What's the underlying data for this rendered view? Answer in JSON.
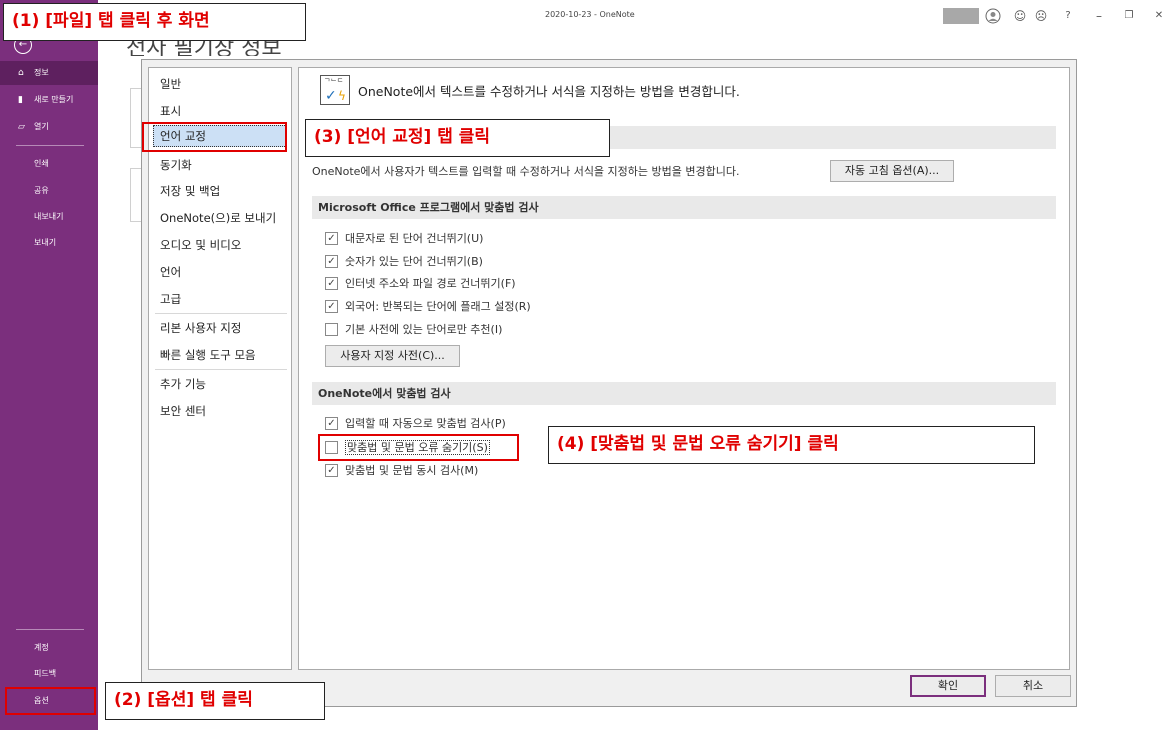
{
  "window": {
    "title": "2020-10-23  -  OneNote",
    "icons": [
      "avatar-icon",
      "smile-icon",
      "frown-icon",
      "help-icon",
      "minimize-icon",
      "restore-icon",
      "close-icon"
    ],
    "icon_glyphs": {
      "smile": "☺",
      "frown": "☹",
      "help": "?",
      "minimize": "–",
      "restore": "❐",
      "close": "✕"
    }
  },
  "leftnav": {
    "back_glyph": "←",
    "top_items": [
      {
        "label": "정보",
        "icon": "home-icon",
        "glyph": "⌂"
      },
      {
        "label": "새로 만들기",
        "icon": "new-page-icon",
        "glyph": "▮"
      },
      {
        "label": "열기",
        "icon": "folder-icon",
        "glyph": "▱"
      }
    ],
    "mid_items": [
      "인쇄",
      "공유",
      "내보내기",
      "보내기"
    ],
    "bottom_items": [
      "계정",
      "피드백",
      "옵션"
    ]
  },
  "backstage": {
    "title": "전자 필기장 정보"
  },
  "dialog": {
    "categories": [
      "일반",
      "표시",
      "언어 교정",
      "동기화",
      "저장 및 백업",
      "OneNote(으)로 보내기",
      "오디오 및 비디오",
      "언어",
      "고급",
      "리본 사용자 지정",
      "빠른 실행 도구 모음",
      "추가 기능",
      "보안 센터"
    ],
    "selected_category": "언어 교정",
    "header_text": "OneNote에서 텍스트를 수정하거나 서식을 지정하는 방법을 변경합니다.",
    "autocorrect": {
      "description": "OneNote에서 사용자가 텍스트를 입력할 때 수정하거나 서식을 지정하는 방법을 변경합니다.",
      "button": "자동 고침 옵션(A)..."
    },
    "office_section": {
      "title": "Microsoft Office 프로그램에서 맞춤법 검사",
      "options": [
        {
          "label": "대문자로 된 단어 건너뛰기(U)",
          "checked": true
        },
        {
          "label": "숫자가 있는 단어 건너뛰기(B)",
          "checked": true
        },
        {
          "label": "인터넷 주소와 파일 경로 건너뛰기(F)",
          "checked": true
        },
        {
          "label": "외국어: 반복되는 단어에 플래그 설정(R)",
          "checked": true
        },
        {
          "label": "기본 사전에 있는 단어로만 추천(I)",
          "checked": false
        }
      ],
      "dict_button": "사용자 지정 사전(C)..."
    },
    "onenote_section": {
      "title": "OneNote에서 맞춤법 검사",
      "options": [
        {
          "label": "입력할 때 자동으로 맞춤법 검사(P)",
          "checked": true
        },
        {
          "label": "맞춤법 및 문법 오류 숨기기(S)",
          "checked": false
        },
        {
          "label": "맞춤법 및 문법 동시 검사(M)",
          "checked": true
        }
      ]
    },
    "ok_button": "확인",
    "cancel_button": "취소"
  },
  "annotations": {
    "step1": "(1) [파일] 탭 클릭 후 화면",
    "step2": "(2) [옵션] 탭 클릭",
    "step3": "(3) [언어 교정] 탭 클릭",
    "step4": "(4) [맞춤법 및 문법 오류 숨기기] 클릭",
    "color": "#e00000"
  },
  "colors": {
    "nav": "#7b2f7d",
    "nav_selected": "#5e205f",
    "selection": "#cce0f5"
  }
}
